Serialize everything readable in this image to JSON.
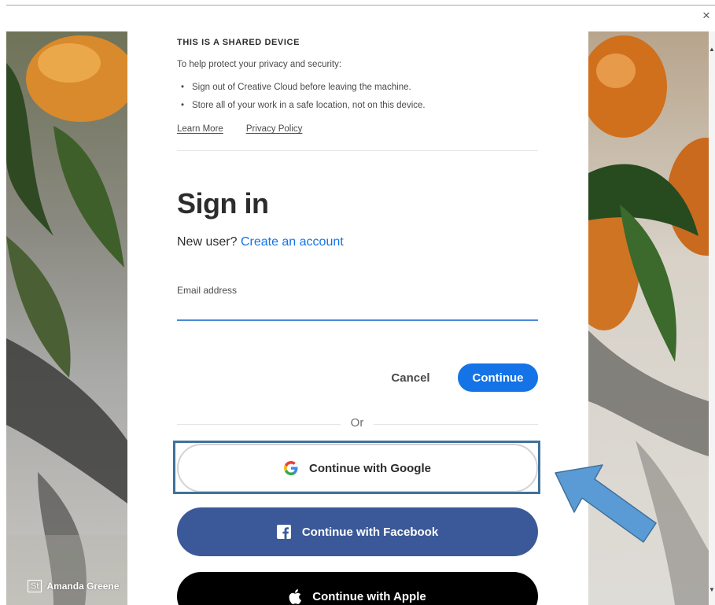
{
  "window": {
    "close_glyph": "×"
  },
  "shared_notice": {
    "title": "THIS IS A SHARED DEVICE",
    "subtitle": "To help protect your privacy and security:",
    "bullets": [
      "Sign out of Creative Cloud before leaving the machine.",
      "Store all of your work in a safe location, not on this device."
    ],
    "learn_more": "Learn More",
    "privacy_policy": "Privacy Policy"
  },
  "signin": {
    "title": "Sign in",
    "new_user_prompt": "New user?",
    "create_account": "Create an account",
    "email_label": "Email address",
    "email_value": "",
    "cancel_label": "Cancel",
    "continue_label": "Continue",
    "or_label": "Or"
  },
  "social": {
    "google_label": "Continue with Google",
    "facebook_label": "Continue with Facebook",
    "apple_label": "Continue with Apple"
  },
  "credit": {
    "logo": "St",
    "author": "Amanda Greene"
  },
  "colors": {
    "accent": "#1473e6",
    "facebook": "#3b5998",
    "apple": "#000000",
    "highlight": "#41719c",
    "arrow": "#5b9bd5"
  },
  "icons": {
    "google": "google-g-icon",
    "facebook": "facebook-f-icon",
    "apple": "apple-logo-icon",
    "close": "close-icon"
  }
}
